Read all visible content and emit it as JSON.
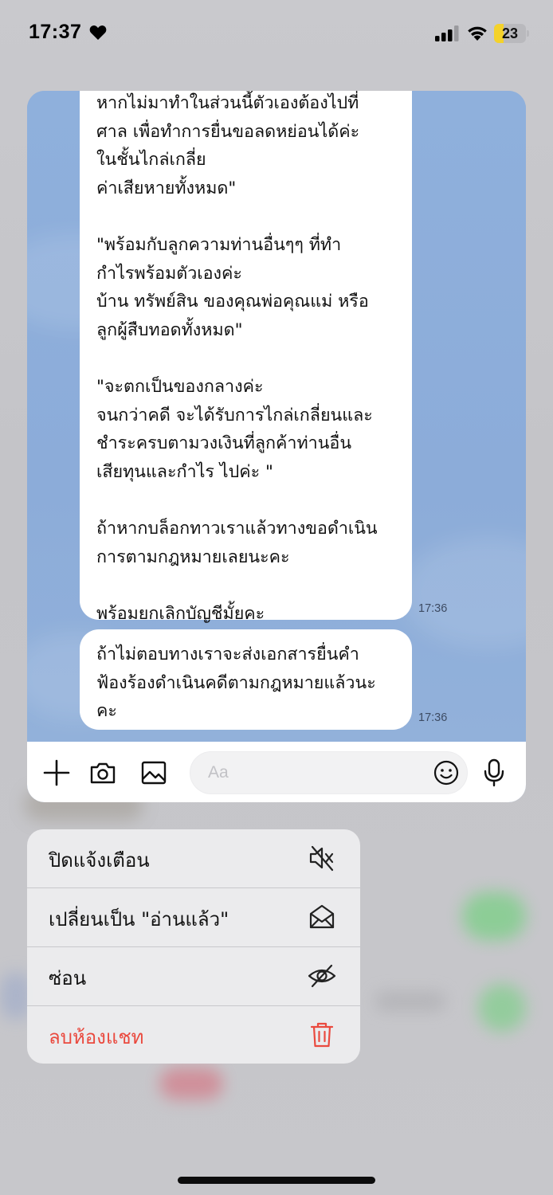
{
  "status_bar": {
    "time": "17:37",
    "battery_level": "23",
    "battery_fraction": 0.23,
    "icons": [
      "heart-icon",
      "signal-icon",
      "wifi-icon",
      "battery-icon"
    ]
  },
  "chat": {
    "messages": [
      {
        "text": "หากไม่มาทำในส่วนนี้ตัวเองต้องไปที่\nศาล เพื่อทำการยื่นขอลดหย่อนได้ค่ะ\nในชั้นไกล่เกลี่ย\nค่าเสียหายทั้งหมด\"\n\n\"พร้อมกับลูกความท่านอื่นๆๆ ที่ทำ\nกำไรพร้อมตัวเองค่ะ\nบ้าน ทรัพย์สิน ของคุณพ่อคุณแม่ หรือ\nลูกผู้สืบทอดทั้งหมด\"\n\n\"จะตกเป็นของกลางค่ะ\nจนกว่าคดี จะได้รับการไกล่เกลี่ยนและ\nชำระครบตามวงเงินที่ลูกค้าท่านอื่น\nเสียทุนและกำไร ไปค่ะ \"\n\nถ้าหากบล็อกทาวเราแล้วทางขอดำเนิน\nการตามกฎหมายเลยนะคะ\n\nพร้อมยกเลิกบัญชีมั้ยคะ",
        "time": "17:36"
      },
      {
        "text": "ถ้าไม่ตอบทางเราจะส่งเอกสารยื่นคำ\nฟ้องร้องดำเนินคดีตามกฎหมายแล้วนะ\nคะ",
        "time": "17:36"
      }
    ],
    "input_placeholder": "Aa",
    "colors": {
      "chat_background": "#8eadd9",
      "bubble": "#ffffff"
    }
  },
  "context_menu": {
    "items": [
      {
        "label": "ปิดแจ้งเตือน",
        "icon": "mute-icon"
      },
      {
        "label": "เปลี่ยนเป็น \"อ่านแล้ว\"",
        "icon": "mark-read-icon"
      },
      {
        "label": "ซ่อน",
        "icon": "hide-icon"
      },
      {
        "label": "ลบห้องแชท",
        "icon": "trash-icon",
        "destructive": true
      }
    ],
    "colors": {
      "destructive": "#ea4a3f"
    }
  }
}
